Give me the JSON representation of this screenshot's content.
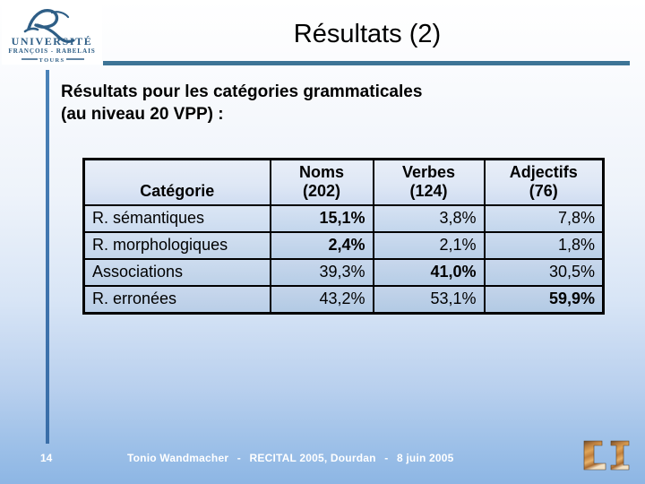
{
  "slide": {
    "title": "Résultats (2)",
    "subtitle_line1": "Résultats pour les catégories grammaticales",
    "subtitle_line2": "(au niveau 20 VPP) :",
    "accent_color": "#3d7496",
    "background_top_color": "#ffffff",
    "background_bottom_color": "#8db6e4"
  },
  "logo": {
    "line1": "UNIVERSITÉ",
    "line2": "FRANÇOIS - RABELAIS",
    "line3": "TOURS",
    "monogram": "R",
    "color": "#2e5e86"
  },
  "table": {
    "headers": [
      {
        "line1": "",
        "line2": "Catégorie"
      },
      {
        "line1": "Noms",
        "line2": "(202)"
      },
      {
        "line1": "Verbes",
        "line2": "(124)"
      },
      {
        "line1": "Adjectifs",
        "line2": "(76)"
      }
    ],
    "rows": [
      {
        "label": "R. sémantiques",
        "cells": [
          {
            "value": "15,1%",
            "bold": true
          },
          {
            "value": "3,8%",
            "bold": false
          },
          {
            "value": "7,8%",
            "bold": false
          }
        ]
      },
      {
        "label": "R. morphologiques",
        "cells": [
          {
            "value": "2,4%",
            "bold": true
          },
          {
            "value": "2,1%",
            "bold": false
          },
          {
            "value": "1,8%",
            "bold": false
          }
        ]
      },
      {
        "label": "Associations",
        "cells": [
          {
            "value": "39,3%",
            "bold": false
          },
          {
            "value": "41,0%",
            "bold": true
          },
          {
            "value": "30,5%",
            "bold": false
          }
        ]
      },
      {
        "label": "R. erronées",
        "cells": [
          {
            "value": "43,2%",
            "bold": false
          },
          {
            "value": "53,1%",
            "bold": false
          },
          {
            "value": "59,9%",
            "bold": true
          }
        ]
      }
    ]
  },
  "footer": {
    "page_number": "14",
    "author": "Tonio Wandmacher",
    "separator": "-",
    "venue": "RECITAL 2005, Dourdan",
    "date": "8 juin 2005",
    "lab_logo_text": "LI"
  }
}
